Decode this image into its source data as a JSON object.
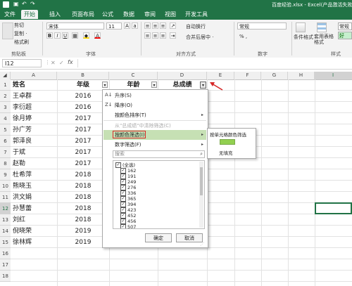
{
  "title": {
    "filename": "百度经验.xlsx - Excel(产品激活失败)"
  },
  "tabs": [
    "文件",
    "开始",
    "插入",
    "页面布局",
    "公式",
    "数据",
    "审阅",
    "视图",
    "开发工具"
  ],
  "active_tab": "开始",
  "ribbon": {
    "cut": "剪切",
    "copy": "复制 ·",
    "format_painter": "格式刷",
    "font_name": "宋体",
    "font_size": "11",
    "wrap_text": "自动换行",
    "merge_center": "合并后居中 ·",
    "number_format": "常规",
    "percent": "% ,",
    "cond_format": "条件格式",
    "format_table": "套用表格格式",
    "style_normal": "常规",
    "style_good": "好",
    "labels": {
      "clipboard": "剪贴板",
      "font": "字体",
      "alignment": "对齐方式",
      "number": "数字",
      "styles": "样式"
    }
  },
  "formula_bar": {
    "name_box": "I12",
    "fx": "fx"
  },
  "columns": [
    "A",
    "B",
    "C",
    "D",
    "E",
    "F",
    "G",
    "H",
    "I"
  ],
  "headers": {
    "name": "姓名",
    "year": "年级",
    "age": "年龄",
    "score": "总成绩"
  },
  "rows": [
    {
      "name": "王卓群",
      "year": "2016"
    },
    {
      "name": "李衍超",
      "year": "2016"
    },
    {
      "name": "徐月婷",
      "year": "2017"
    },
    {
      "name": "孙广芳",
      "year": "2017"
    },
    {
      "name": "郭泽良",
      "year": "2017"
    },
    {
      "name": "于斌",
      "year": "2017"
    },
    {
      "name": "赵勒",
      "year": "2017"
    },
    {
      "name": "杜希萍",
      "year": "2018"
    },
    {
      "name": "熊晓玉",
      "year": "2018"
    },
    {
      "name": "洪文娟",
      "year": "2018"
    },
    {
      "name": "孙慧蕾",
      "year": "2018"
    },
    {
      "name": "刘红",
      "year": "2018"
    },
    {
      "name": "倪晓荣",
      "year": "2019"
    },
    {
      "name": "徐林辉",
      "year": "2019"
    }
  ],
  "row_numbers": [
    "1",
    "2",
    "3",
    "4",
    "5",
    "6",
    "7",
    "8",
    "9",
    "10",
    "11",
    "12",
    "13",
    "14",
    "15",
    "16",
    "17",
    "18"
  ],
  "filter_menu": {
    "sort_asc": "升序(S)",
    "sort_desc": "降序(O)",
    "sort_by_color": "按颜色排序(T)",
    "clear_filter": "从\"总成绩\"中清除筛选(C)",
    "filter_by_color": "按颜色筛选(I)",
    "number_filters": "数字筛选(F)",
    "search_placeholder": "搜索",
    "values": [
      "(全选)",
      "162",
      "191",
      "249",
      "276",
      "336",
      "365",
      "394",
      "423",
      "452",
      "456",
      "507"
    ],
    "ok": "确定",
    "cancel": "取消"
  },
  "color_submenu": {
    "title": "按单元格颜色筛选",
    "no_fill": "无填充",
    "swatch_color": "#92d050"
  },
  "colors": {
    "excel_green": "#217346",
    "highlight_red": "#d62828",
    "selected_border": "#217346"
  }
}
